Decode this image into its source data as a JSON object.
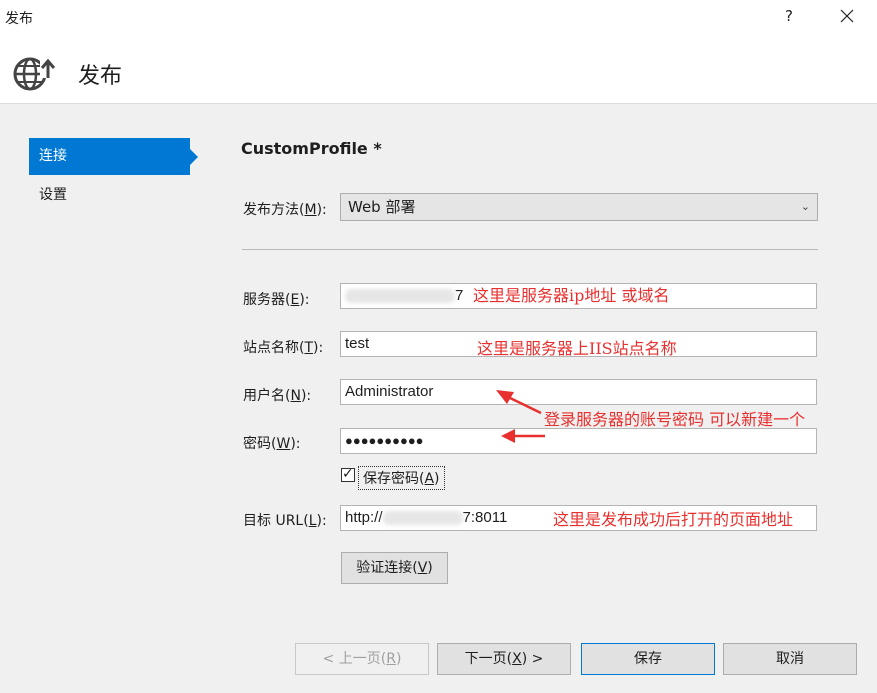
{
  "window": {
    "title": "发布",
    "help_label": "?"
  },
  "header": {
    "title": "发布",
    "icon": "globe-publish-icon"
  },
  "sidebar": {
    "items": [
      {
        "label": "连接",
        "active": true
      },
      {
        "label": "设置",
        "active": false
      }
    ]
  },
  "profile": {
    "name": "CustomProfile *"
  },
  "publish_method": {
    "label": "发布方法(",
    "key": "M",
    "label_end": "):",
    "value": "Web 部署"
  },
  "server": {
    "label": "服务器(",
    "key": "E",
    "label_end": "):",
    "value_suffix": "7"
  },
  "site_name": {
    "label": "站点名称(",
    "key": "T",
    "label_end": "):",
    "value": "test"
  },
  "username": {
    "label": "用户名(",
    "key": "N",
    "label_end": "):",
    "value": "Administrator"
  },
  "password": {
    "label": "密码(",
    "key": "W",
    "label_end": "):",
    "value": "●●●●●●●●●●"
  },
  "save_password": {
    "label": "保存密码(",
    "key": "A",
    "label_end": ")",
    "checked": true
  },
  "target_url": {
    "label": "目标 URL(",
    "key": "L",
    "label_end": "):",
    "value_prefix": "http://",
    "value_suffix": "7:8011"
  },
  "validate_button": {
    "label": "验证连接(",
    "key": "V",
    "label_end": ")"
  },
  "footer": {
    "prev": {
      "label": "< 上一页(",
      "key": "R",
      "label_end": ")"
    },
    "next": {
      "label": "下一页(",
      "key": "X",
      "label_end": ") >"
    },
    "save": {
      "label": "保存"
    },
    "cancel": {
      "label": "取消"
    }
  },
  "annotations": {
    "server_note": "这里是服务器ip地址 或域名",
    "site_note": "这里是服务器上IIS站点名称",
    "credentials_note": "登录服务器的账号密码   可以新建一个",
    "url_note": "这里是发布成功后打开的页面地址"
  },
  "colors": {
    "accent": "#0078d4",
    "annotation": "#e8302e"
  }
}
